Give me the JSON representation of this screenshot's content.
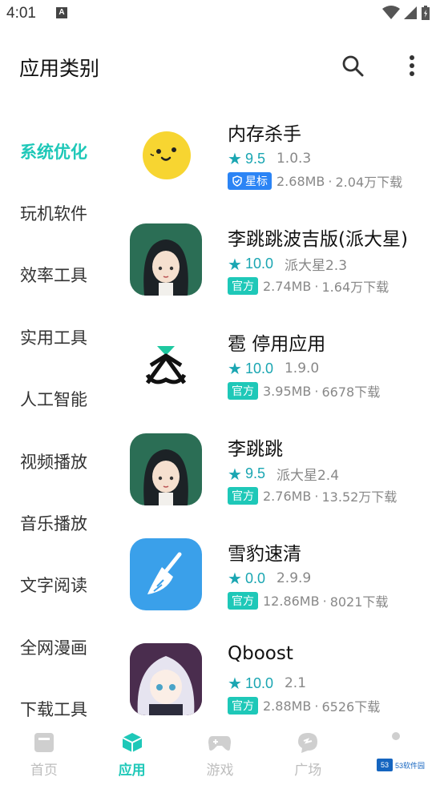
{
  "status_bar": {
    "time": "4:01",
    "notif_letter": "A"
  },
  "header": {
    "title": "应用类别",
    "search_icon": "search-icon",
    "more_icon": "more-vertical-icon"
  },
  "sidebar": {
    "items": [
      {
        "label": "系统优化",
        "active": true
      },
      {
        "label": "玩机软件"
      },
      {
        "label": "效率工具"
      },
      {
        "label": "实用工具"
      },
      {
        "label": "人工智能"
      },
      {
        "label": "视频播放"
      },
      {
        "label": "音乐播放"
      },
      {
        "label": "文字阅读"
      },
      {
        "label": "全网漫画"
      },
      {
        "label": "下载工具"
      }
    ]
  },
  "apps": [
    {
      "name": "内存杀手",
      "rating": "9.5",
      "version": "1.0.3",
      "badge": "星标",
      "size": "2.68MB",
      "downloads": "2.04万下载",
      "icon": "smiley-face-icon"
    },
    {
      "name": "李跳跳波吉版(派大星)",
      "rating": "10.0",
      "version": "派大星2.3",
      "badge": "官方",
      "size": "2.74MB",
      "downloads": "1.64万下载",
      "icon": "anime-girl-icon"
    },
    {
      "name": "雹 停用应用",
      "rating": "10.0",
      "version": "1.9.0",
      "badge": "官方",
      "size": "3.95MB",
      "downloads": "6678下载",
      "icon": "hourglass-logo-icon"
    },
    {
      "name": "李跳跳",
      "rating": "9.5",
      "version": "派大星2.4",
      "badge": "官方",
      "size": "2.76MB",
      "downloads": "13.52万下载",
      "icon": "anime-girl-icon"
    },
    {
      "name": "雪豹速清",
      "rating": "0.0",
      "version": "2.9.9",
      "badge": "官方",
      "size": "12.86MB",
      "downloads": "8021下载",
      "icon": "broom-icon"
    },
    {
      "name": "Qboost",
      "rating": "10.0",
      "version": "2.1",
      "badge": "官方",
      "size": "2.88MB",
      "downloads": "6526下载",
      "icon": "anime-avatar-icon"
    }
  ],
  "separator": "·",
  "bottom_nav": [
    {
      "label": "首页",
      "icon": "home-icon"
    },
    {
      "label": "应用",
      "icon": "cube-icon",
      "active": true
    },
    {
      "label": "游戏",
      "icon": "gamepad-icon"
    },
    {
      "label": "广场",
      "icon": "chat-icon"
    },
    {
      "label": "",
      "icon": "profile-icon"
    }
  ],
  "watermark": {
    "logo": "53",
    "text": "53软件园"
  },
  "colors": {
    "accent": "#1ec8b8",
    "rating": "#1aa6b2",
    "star_badge": "#2b84f5"
  }
}
